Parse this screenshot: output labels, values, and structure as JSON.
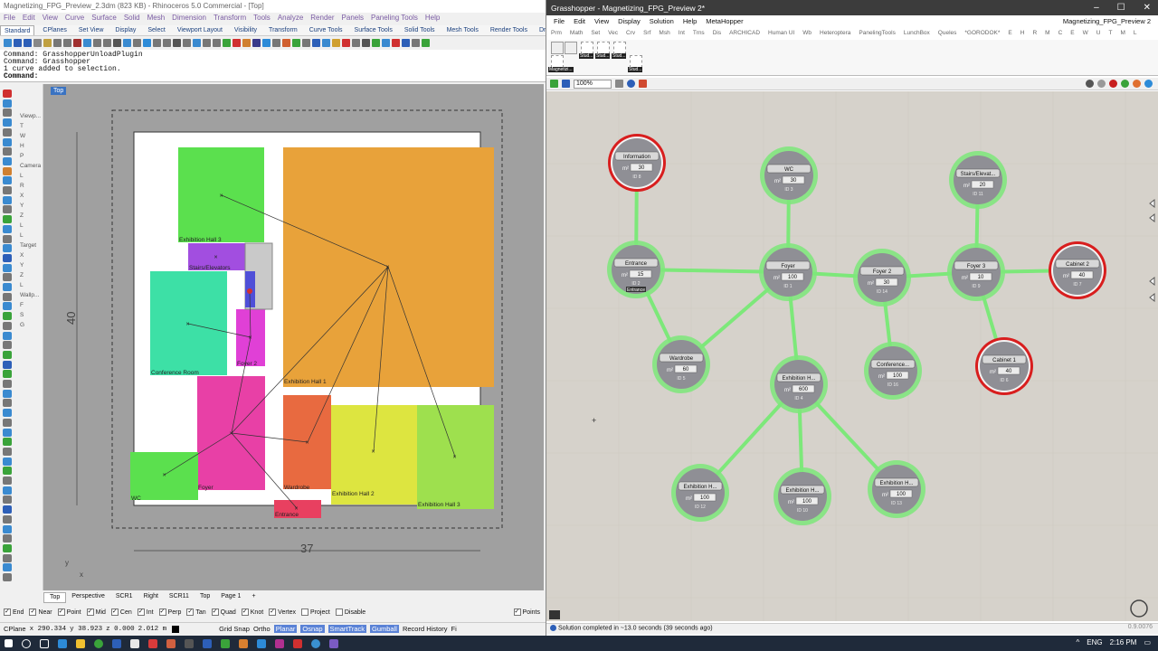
{
  "rhino": {
    "title": "Magnetizing_FPG_Preview_2.3dm (823 KB) - Rhinoceros 5.0 Commercial - [Top]",
    "menu": [
      "File",
      "Edit",
      "View",
      "Curve",
      "Surface",
      "Solid",
      "Mesh",
      "Dimension",
      "Transform",
      "Tools",
      "Analyze",
      "Render",
      "Panels",
      "Paneling Tools",
      "Help"
    ],
    "tabs": [
      "Standard",
      "CPlanes",
      "Set View",
      "Display",
      "Select",
      "Viewport Layout",
      "Visibility",
      "Transform",
      "Curve Tools",
      "Surface Tools",
      "Solid Tools",
      "Mesh Tools",
      "Render Tools",
      "Drafting"
    ],
    "command_history": [
      "Command: GrasshopperUnloadPlugin",
      "Command: Grasshopper",
      "1 curve added to selection."
    ],
    "command_prompt": "Command:",
    "viewport_label": "Top",
    "left_panel": [
      "Viewp...",
      "T",
      "W",
      "H",
      "P",
      "Camera",
      "L",
      "R",
      "X",
      "Y",
      "Z",
      "L",
      "L",
      "Target",
      "X",
      "Y",
      "Z",
      "L",
      "Wallp...",
      "F",
      "S",
      "G"
    ],
    "dims": {
      "height": "40",
      "width": "37"
    },
    "rooms": [
      {
        "name": "Exhibition Hall 3",
        "color": "#5be04e"
      },
      {
        "name": "Exhibition Hall 1",
        "color": "#e8a23a"
      },
      {
        "name": "Stairs/Elevators",
        "color": "#a24ee0"
      },
      {
        "name": "Foyer 3",
        "color": "#4f4fd8"
      },
      {
        "name": "Foyer 2",
        "color": "#e040d6"
      },
      {
        "name": "Conference Room",
        "color": "#3de0a6"
      },
      {
        "name": "Foyer",
        "color": "#e840a6"
      },
      {
        "name": "WC",
        "color": "#5be04e"
      },
      {
        "name": "Wardrobe",
        "color": "#e86a40"
      },
      {
        "name": "Exhibition Hall 2",
        "color": "#dde540"
      },
      {
        "name": "Exhibition Hall 3",
        "color": "#9ee04e"
      },
      {
        "name": "Entrance",
        "color": "#e84060"
      }
    ],
    "view_tabs": [
      "Top",
      "Perspective",
      "SCR1",
      "Right",
      "SCR11",
      "Top",
      "Page 1"
    ],
    "osnaps": [
      "End",
      "Near",
      "Point",
      "Mid",
      "Cen",
      "Int",
      "Perp",
      "Tan",
      "Quad",
      "Knot",
      "Vertex",
      "Project",
      "Disable"
    ],
    "osnap_checked": [
      true,
      true,
      true,
      true,
      true,
      true,
      true,
      true,
      true,
      true,
      true,
      false,
      false
    ],
    "points_label": "Points",
    "status": {
      "cplane": "CPlane",
      "x": "x 290.334",
      "y": "y 38.923",
      "z": "z 0.000",
      "dist": "2.012 m",
      "toggles": [
        "Grid Snap",
        "Ortho",
        "Planar",
        "Osnap",
        "SmartTrack",
        "Gumball",
        "Record History",
        "Fi"
      ],
      "toggles_on": [
        false,
        false,
        true,
        true,
        true,
        true,
        false,
        false
      ]
    }
  },
  "gh": {
    "title": "Grasshopper - Magnetizing_FPG_Preview 2*",
    "doc_title": "Magnetizing_FPG_Preview 2",
    "window_buttons": [
      "–",
      "☐",
      "✕"
    ],
    "menu": [
      "File",
      "Edit",
      "View",
      "Display",
      "Solution",
      "Help",
      "MetaHopper"
    ],
    "cat_tabs": [
      "Prm",
      "Math",
      "Set",
      "Vec",
      "Crv",
      "Srf",
      "Msh",
      "Int",
      "Trns",
      "Dis",
      "ARCHICAD",
      "Human UI",
      "Wb",
      "Heteroptera",
      "PanelingTools",
      "LunchBox",
      "Queles",
      "*GORODOK*",
      "E",
      "H",
      "R",
      "M",
      "C",
      "E",
      "W",
      "U",
      "T",
      "M",
      "L"
    ],
    "ribbon_tags": [
      "Magnetizi...",
      "Stud...",
      "Stud...",
      "Stud...",
      "Stud..."
    ],
    "zoom": "100%",
    "status_text": "Solution completed in ~13.0 seconds (39 seconds ago)",
    "version": "0.9.0076",
    "unit": "m²",
    "nodes": [
      {
        "name": "Information",
        "area": "30",
        "id": "ID 8",
        "warn": true
      },
      {
        "name": "WC",
        "area": "30",
        "id": "ID 3",
        "warn": false
      },
      {
        "name": "Stairs/Elevat...",
        "area": "20",
        "id": "ID 11",
        "warn": false
      },
      {
        "name": "Entrance",
        "area": "15",
        "id": "ID 2",
        "warn": false
      },
      {
        "name": "Foyer",
        "area": "100",
        "id": "ID 1",
        "warn": false
      },
      {
        "name": "Foyer 2",
        "area": "30",
        "id": "ID 14",
        "warn": false
      },
      {
        "name": "Foyer 3",
        "area": "10",
        "id": "ID 9",
        "warn": false
      },
      {
        "name": "Cabinet 2",
        "area": "40",
        "id": "ID 7",
        "warn": true
      },
      {
        "name": "Wardrobe",
        "area": "60",
        "id": "ID 5",
        "warn": false
      },
      {
        "name": "Exhibition H...",
        "area": "600",
        "id": "ID 4",
        "warn": false
      },
      {
        "name": "Conference...",
        "area": "100",
        "id": "ID 16",
        "warn": false
      },
      {
        "name": "Cabinet 1",
        "area": "40",
        "id": "ID 6",
        "warn": true
      },
      {
        "name": "Exhibition H...",
        "area": "100",
        "id": "ID 12",
        "warn": false
      },
      {
        "name": "Exhibition H...",
        "area": "100",
        "id": "ID 10",
        "warn": false
      },
      {
        "name": "Exhibition H...",
        "area": "100",
        "id": "ID 13",
        "warn": false
      }
    ],
    "entrance_extra": "Entrance",
    "colors": {
      "ok_ring": "#7de87a",
      "warn_ring": "#d81e1e",
      "edge": "#7de87a",
      "node": "#8f8f95"
    }
  },
  "taskbar": {
    "lang": "ENG",
    "time": "2:16 PM"
  }
}
